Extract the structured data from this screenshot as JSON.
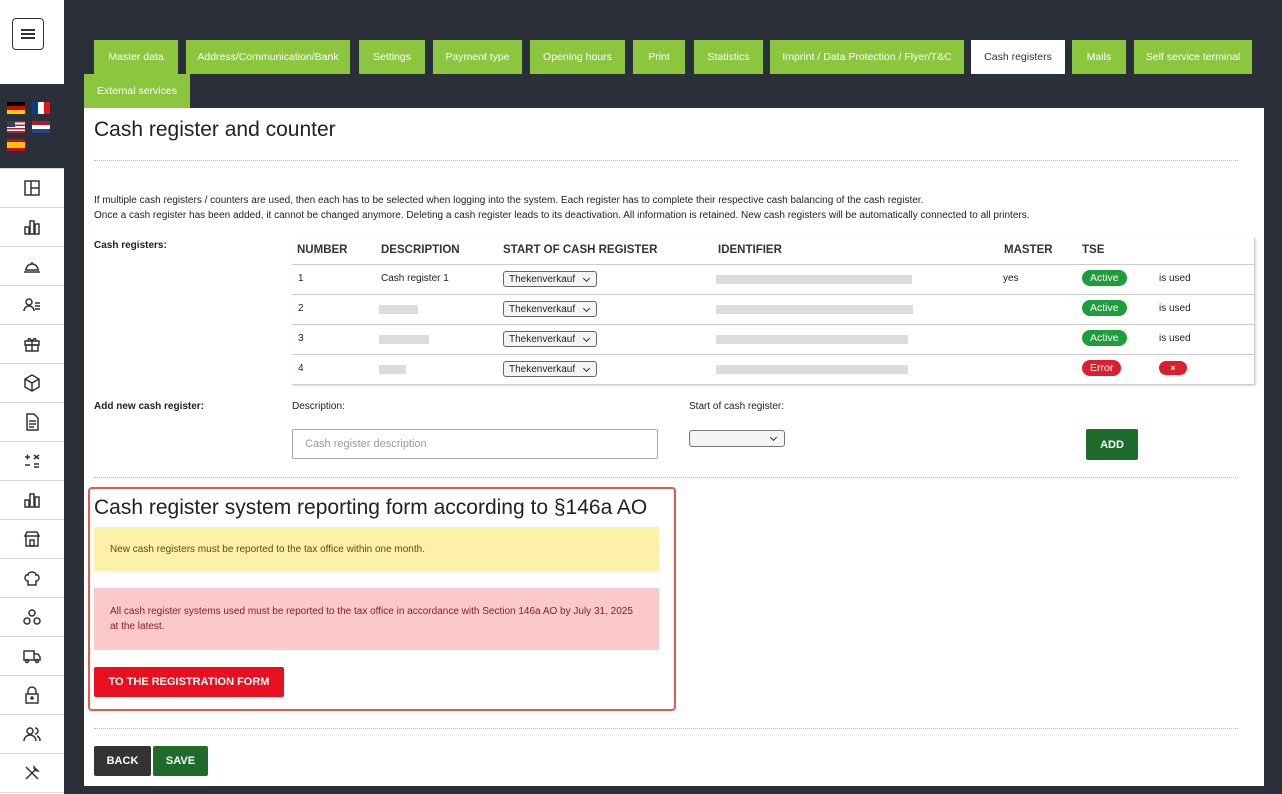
{
  "tabs": [
    {
      "label": "Master data",
      "active": false
    },
    {
      "label": "Address/Communication/Bank",
      "active": false
    },
    {
      "label": "Settings",
      "active": false
    },
    {
      "label": "Payment type",
      "active": false
    },
    {
      "label": "Opening hours",
      "active": false
    },
    {
      "label": "Print",
      "active": false
    },
    {
      "label": "Statistics",
      "active": false
    },
    {
      "label": "Imprint / Data Protection / Flyer/T&C",
      "active": false
    },
    {
      "label": "Cash registers",
      "active": true
    },
    {
      "label": "Mails",
      "active": false
    },
    {
      "label": "Self service terminal",
      "active": false
    },
    {
      "label": "External services",
      "active": false
    }
  ],
  "page": {
    "title": "Cash register and counter",
    "info_line1": "If multiple cash registers / counters are used, then each has to be selected when logging into the system. Each register has to complete their respective cash balancing of the cash register.",
    "info_line2": "Once a cash register has been added, it cannot be changed anymore. Deleting a cash register leads to its deactivation. All information is retained. New cash registers will be automatically connected to all printers."
  },
  "registers": {
    "label": "Cash registers:",
    "headers": {
      "number": "NUMBER",
      "description": "DESCRIPTION",
      "start": "START OF CASH REGISTER",
      "identifier": "IDENTIFIER",
      "master": "MASTER",
      "tse": "TSE"
    },
    "rows": [
      {
        "number": "1",
        "description": "Cash register 1",
        "start": "Thekenverkauf",
        "master": "yes",
        "tse": "Active",
        "status": "is used"
      },
      {
        "number": "2",
        "description": "",
        "start": "Thekenverkauf",
        "master": "",
        "tse": "Active",
        "status": "is used"
      },
      {
        "number": "3",
        "description": "",
        "start": "Thekenverkauf",
        "master": "",
        "tse": "Active",
        "status": "is used"
      },
      {
        "number": "4",
        "description": "",
        "start": "Thekenverkauf",
        "master": "",
        "tse": "Error",
        "status": "×"
      }
    ]
  },
  "add_new": {
    "label": "Add new cash register:",
    "description_label": "Description:",
    "description_placeholder": "Cash register description",
    "start_label": "Start of cash register:",
    "start_value": "",
    "add_button": "ADD"
  },
  "report": {
    "title": "Cash register system reporting form according to §146a AO",
    "notice_yellow": "New cash registers must be reported to the tax office within one month.",
    "notice_red": "All cash register systems used must be reported to the tax office in accordance with Section 146a AO by July 31, 2025 at the latest.",
    "button": "TO THE REGISTRATION FORM"
  },
  "footer": {
    "back": "BACK",
    "save": "SAVE"
  },
  "colors": {
    "tab_green": "#8cc63f",
    "dark_green": "#1e6b2c",
    "badge_green": "#1d9e3a",
    "badge_red": "#dc1f2e",
    "cta_red": "#e8101f",
    "report_border": "#e2594e"
  }
}
